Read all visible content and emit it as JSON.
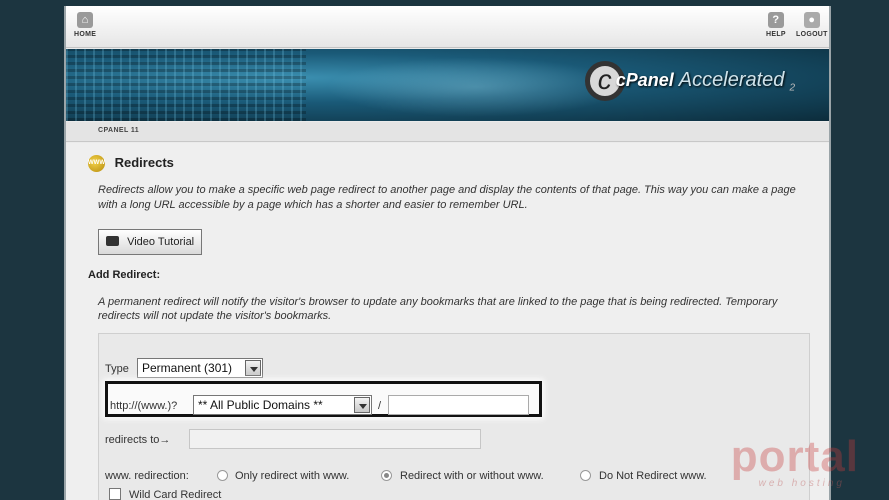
{
  "topnav": {
    "home": "HOME",
    "help": "HELP",
    "logout": "LOGOUT"
  },
  "banner": {
    "logo_c": "c",
    "logo_panel": "cPanel",
    "logo_accelerated": "Accelerated",
    "logo_version": "2"
  },
  "breadcrumb": "CPANEL 11",
  "page": {
    "title": "Redirects",
    "description": "Redirects allow you to make a specific web page redirect to another page and display the contents of that page. This way you can make a page with a long URL accessible by a page which has a shorter and easier to remember URL.",
    "video_button": "Video Tutorial",
    "add_header": "Add Redirect:",
    "perm_description": "A permanent redirect will notify the visitor's browser to update any bookmarks that are linked to the page that is being redirected. Temporary redirects will not update the visitor's bookmarks."
  },
  "form": {
    "type_label": "Type",
    "type_value": "Permanent (301)",
    "url_prefix": "http://(www.)?",
    "domain_value": "** All Public Domains **",
    "slash": "/",
    "path_value": "",
    "redirects_to_label": "redirects to→",
    "redirects_to_value": "",
    "www_label": "www. redirection:",
    "www_options": [
      "Only redirect with www.",
      "Redirect with or without www.",
      "Do Not Redirect www."
    ],
    "www_selected": "Redirect with or without www.",
    "wildcard_label": "Wild Card Redirect",
    "wildcard_checked": false
  },
  "watermark": {
    "main": "portal",
    "sub": "web hosting"
  }
}
